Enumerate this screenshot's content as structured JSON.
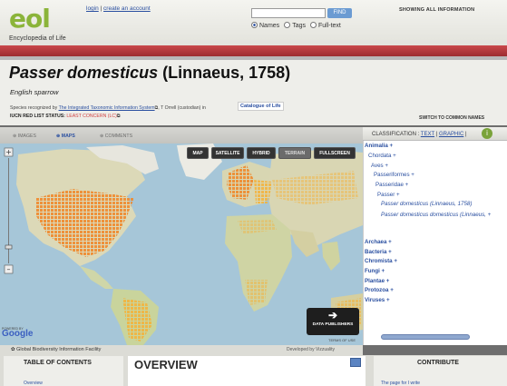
{
  "header": {
    "logo_text": "eol",
    "logo_subtitle": "Encyclopedia of Life",
    "login_label": "login",
    "create_account_label": "create an account",
    "find_label": "FIND",
    "search_options": [
      "Names",
      "Tags",
      "Full-text"
    ],
    "selected_option": "Names",
    "show_all_label": "SHOWING ALL INFORMATION"
  },
  "taxon": {
    "scientific_name": "Passer domesticus",
    "author": "(Linnaeus, 1758)",
    "common_name": "English sparrow",
    "recognized_prefix": "Species recognized by",
    "recognized_source": "The Integrated Taxonomic Information System",
    "recognized_custodian": "T Orrell (custodian) in",
    "catalogue_label": "Catalogue of Life",
    "iucn_label": "IUCN RED LIST STATUS:",
    "iucn_status": "LEAST CONCERN (LC)",
    "switch_label": "SWITCH TO COMMON NAMES"
  },
  "tabs": [
    "IMAGES",
    "MAPS",
    "COMMENTS"
  ],
  "active_tab": "MAPS",
  "map": {
    "buttons": [
      "MAP",
      "SATELLITE",
      "HYBRID",
      "TERRAIN",
      "FULLSCREEN"
    ],
    "data_publishers_label": "DATA PUBLISHERS",
    "powered_by": "POWERED BY",
    "google_label": "Google",
    "terms_label": "TERMS OF USE",
    "gbif_label": "Global Biodiversity Information Facility",
    "developed_by": "Developed by Vizzuality"
  },
  "classification": {
    "label": "CLASSIFICATION :",
    "text_link": "TEXT",
    "graphic_link": "GRAPHIC",
    "tree": [
      "Animalia +",
      "Chordata +",
      "Aves +",
      "Passeriformes +",
      "Passeridae +",
      "Passer +",
      "Passer domesticus (Linnaeus, 1758)",
      "Passer domesticus domesticus (Linnaeus, +"
    ],
    "kingdoms": [
      "Archaea +",
      "Bacteria +",
      "Chromista +",
      "Fungi +",
      "Plantae +",
      "Protozoa +",
      "Viruses +"
    ]
  },
  "bottom": {
    "toc_title": "TABLE OF CONTENTS",
    "toc_item": "Overview",
    "overview_title": "OVERVIEW",
    "contribute_title": "CONTRIBUTE",
    "contribute_item": "The page for I write"
  }
}
